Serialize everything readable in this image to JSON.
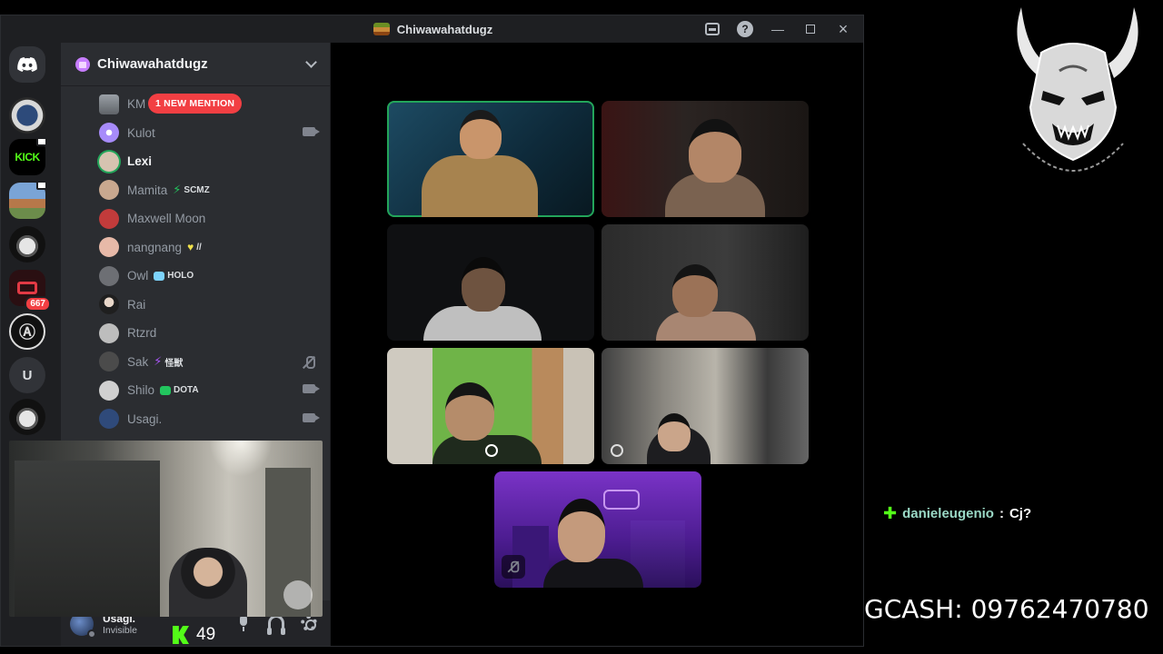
{
  "window": {
    "title": "Chiwawahatdugz"
  },
  "guild": {
    "name": "Chiwawahatdugz"
  },
  "rail": {
    "servers": [
      {
        "name": "home",
        "label": ""
      },
      {
        "name": "server-seal",
        "label": ""
      },
      {
        "name": "server-kick",
        "label": "KICK"
      },
      {
        "name": "server-photo",
        "label": ""
      },
      {
        "name": "server-oni",
        "label": ""
      },
      {
        "name": "server-red",
        "label": "",
        "badge": "667"
      },
      {
        "name": "server-ap",
        "label": ""
      },
      {
        "name": "server-u",
        "label": "U"
      },
      {
        "name": "server-oni-2",
        "label": ""
      }
    ]
  },
  "members": [
    {
      "name": "KM",
      "avatar": "#8b8f96",
      "mention": "1 NEW MENTION"
    },
    {
      "name": "Kulot",
      "avatar": "#a78bfa",
      "right": "camera"
    },
    {
      "name": "Lexi",
      "avatar": "#d6c3b0",
      "active": true
    },
    {
      "name": "Mamita",
      "avatar": "#c9a88f",
      "tag": "SCMZ",
      "tagColor": "#5865f2"
    },
    {
      "name": "Maxwell Moon",
      "avatar": "#c23b3b"
    },
    {
      "name": "nangnang",
      "avatar": "#e7b9a8",
      "tag": "//",
      "tagColor": "#f0e14a"
    },
    {
      "name": "Owl",
      "avatar": "#6d6f74",
      "tag": "HOLO",
      "tagColor": "#7dd3fc"
    },
    {
      "name": "Rai",
      "avatar": "#3a3a3a"
    },
    {
      "name": "Rtzrd",
      "avatar": "#bdbdbd"
    },
    {
      "name": "Sak",
      "avatar": "#4b4b4b",
      "tag": "怪獣",
      "tagColor": "#a855f7",
      "right": "mic-off"
    },
    {
      "name": "Shilo",
      "avatar": "#d0d0d0",
      "tag": "DOTA",
      "tagColor": "#22c55e",
      "right": "camera"
    },
    {
      "name": "Usagi.",
      "avatar": "#2f4a7a",
      "right": "camera"
    }
  ],
  "user_panel": {
    "name": "Usagi.",
    "status": "Invisible"
  },
  "overlay": {
    "chat": {
      "user": "danieleugenio",
      "separator": " : ",
      "message": "Cj?"
    },
    "gcash": "GCASH: 09762470780",
    "kick_viewers": "49"
  },
  "colors": {
    "accent_green": "#23a55a",
    "mention_red": "#f23f43",
    "kick_green": "#53fc18"
  }
}
